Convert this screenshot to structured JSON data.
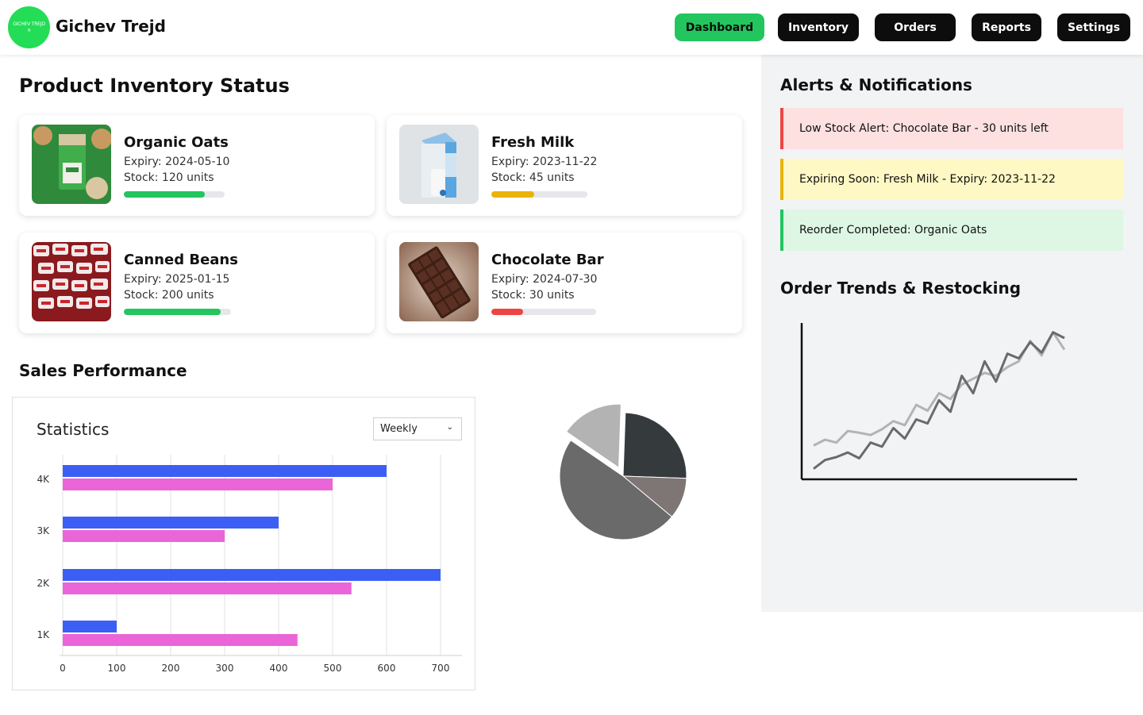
{
  "header": {
    "logo_text": "GICHEV TREJD",
    "logo_sub": "®",
    "brand": "Gichev Trejd",
    "nav": [
      {
        "label": "Dashboard",
        "active": true
      },
      {
        "label": "Inventory",
        "active": false
      },
      {
        "label": "Orders",
        "active": false
      },
      {
        "label": "Reports",
        "active": false
      },
      {
        "label": "Settings",
        "active": false
      }
    ]
  },
  "inventory": {
    "title": "Product Inventory Status",
    "products": [
      {
        "name": "Organic Oats",
        "expiry": "Expiry: 2024-05-10",
        "stock": "Stock: 120 units",
        "fill": 0.8,
        "color": "#22c55e"
      },
      {
        "name": "Fresh Milk",
        "expiry": "Expiry: 2023-11-22",
        "stock": "Stock: 45 units",
        "fill": 0.45,
        "color": "#eab308"
      },
      {
        "name": "Canned Beans",
        "expiry": "Expiry: 2025-01-15",
        "stock": "Stock: 200 units",
        "fill": 0.9,
        "color": "#22c55e"
      },
      {
        "name": "Chocolate Bar",
        "expiry": "Expiry: 2024-07-30",
        "stock": "Stock: 30 units",
        "fill": 0.3,
        "color": "#ef4444"
      }
    ]
  },
  "sales": {
    "title": "Sales Performance",
    "stats_title": "Statistics",
    "period": "Weekly"
  },
  "alerts": {
    "title": "Alerts & Notifications",
    "items": [
      {
        "text": "Low Stock Alert: Chocolate Bar - 30 units left",
        "level": "red"
      },
      {
        "text": "Expiring Soon: Fresh Milk - Expiry: 2023-11-22",
        "level": "yellow"
      },
      {
        "text": "Reorder Completed: Organic Oats",
        "level": "green"
      }
    ]
  },
  "trends": {
    "title": "Order Trends & Restocking"
  },
  "chart_data": [
    {
      "type": "bar",
      "orientation": "horizontal",
      "categories": [
        "4K",
        "3K",
        "2K",
        "1K"
      ],
      "series": [
        {
          "values": [
            600,
            400,
            700,
            100
          ],
          "color": "#3b5ff5"
        },
        {
          "values": [
            500,
            300,
            535,
            435
          ],
          "color": "#ea65d8"
        }
      ],
      "xticks": [
        "0",
        "100",
        "200",
        "300",
        "400",
        "500",
        "600",
        "700"
      ],
      "xlim": [
        0,
        700
      ],
      "grid": true
    },
    {
      "type": "pie",
      "slices": [
        {
          "value": 25,
          "color": "#353b3d"
        },
        {
          "value": 10.5,
          "color": "#7e7575"
        },
        {
          "value": 48.5,
          "color": "#6a6a6a"
        },
        {
          "value": 16,
          "color": "#b3b3b3"
        }
      ]
    },
    {
      "type": "line",
      "series": [
        {
          "values": [
            10,
            25,
            30,
            38,
            28,
            55,
            48,
            80,
            62,
            95,
            88,
            128,
            108,
            170,
            140,
            195,
            160,
            208,
            200,
            228,
            210,
            245,
            235
          ],
          "color": "#6a6a6a"
        },
        {
          "values": [
            50,
            60,
            55,
            75,
            72,
            68,
            78,
            92,
            85,
            120,
            110,
            140,
            130,
            155,
            165,
            175,
            170,
            185,
            195,
            230,
            205,
            245,
            215
          ],
          "color": "#b3b3b3"
        }
      ],
      "grid": false
    }
  ]
}
